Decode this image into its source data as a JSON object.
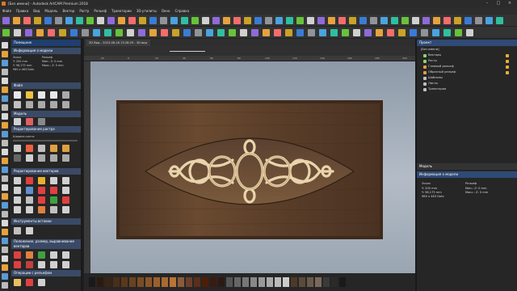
{
  "app": {
    "title": "[Без имени] - Autodesk ArtCAM Premium 2018"
  },
  "menu": [
    "Файл",
    "Правка",
    "Вид",
    "Модель",
    "Вектор",
    "Растр",
    "Рельеф",
    "Траектории",
    "3D-утилиты",
    "Окно",
    "Справка"
  ],
  "left_panel": {
    "header": "Помощник",
    "model_info_title": "Информация о модели",
    "model_info": {
      "col1_head": "Эскиз",
      "col1_l1": "Y: 200 mm",
      "col1_l2": "Y: 98,175 mm",
      "col1_l3": "980 x 463 Dots",
      "col2_head": "Рельеф",
      "col2_l1": "Мин.: Z: 0 mm",
      "col2_l2": "Макс.: Z: 0 mm"
    },
    "section_file": "Файл",
    "section_model": "Модель",
    "section_raster": "Редактирование растра",
    "raster_label": "Ширина кисти:",
    "section_vectors": "Редактирование векторов",
    "section_tools": "Инструменты вставки",
    "section_position": "Положение, размер, выравнивание векторов",
    "section_relief": "Операции с рельефом"
  },
  "view": {
    "tab": "2D Вид - 2023-08-18 13:28:29 - 3D вид",
    "ruler_ticks": [
      "-20",
      "0",
      "20",
      "40",
      "60",
      "80",
      "100",
      "120",
      "140",
      "160",
      "180",
      "200"
    ]
  },
  "right_panel": {
    "project_header": "Проект",
    "root": "[Без имени]",
    "tree": [
      "Векторы",
      "Растр",
      "Главный рельеф",
      "Образный рельеф",
      "Шаблоны",
      "Листы",
      "Траектории"
    ],
    "model_tab": "Модель",
    "info_title": "Информация о модели",
    "info": {
      "c1h": "Эскиз",
      "c1a": "Y: 200 mm",
      "c1b": "Y: 98,175 mm",
      "c1c": "980 x 463 Dots",
      "c2h": "Рельеф",
      "c2a": "Мин.: Z: 0 mm",
      "c2b": "Макс.: Z: 0 mm"
    }
  },
  "colors": {
    "accent_blue": "#1f3f6e",
    "wood_dark": "#4a3323",
    "wood_light": "#7a5a3a",
    "knot": "#e8d2a8"
  }
}
